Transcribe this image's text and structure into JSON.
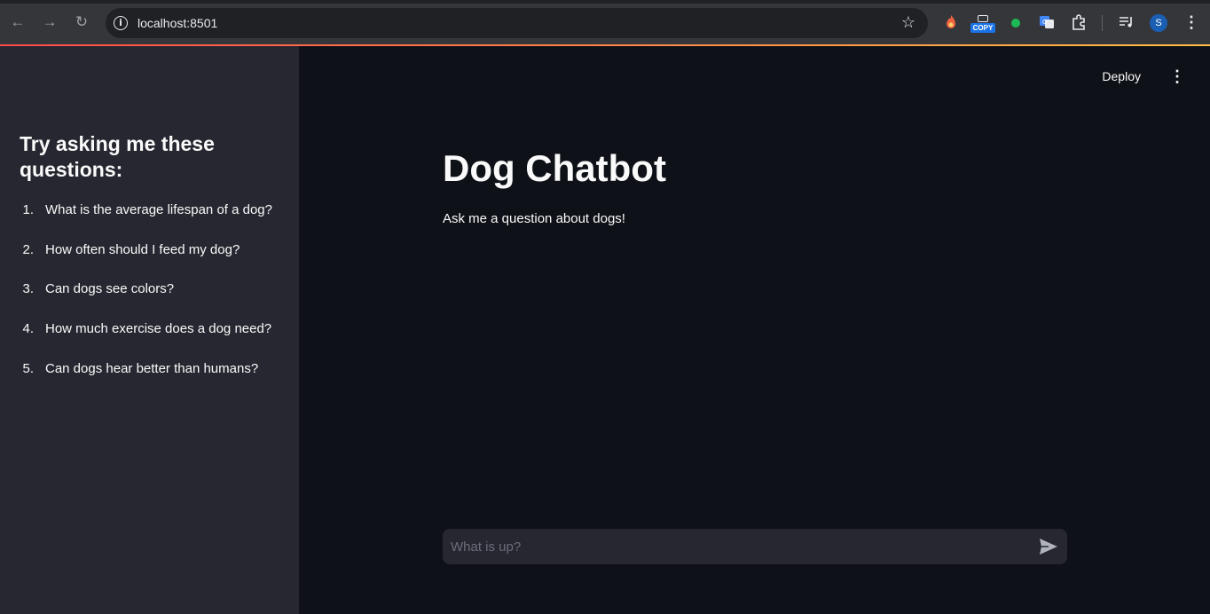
{
  "browser": {
    "url": "localhost:8501",
    "profile_initial": "S",
    "copy_ext_label": "COPY"
  },
  "sidebar": {
    "heading": "Try asking me these questions:",
    "questions": [
      {
        "num": "1.",
        "text": "What is the average lifespan of a dog?"
      },
      {
        "num": "2.",
        "text": "How often should I feed my dog?"
      },
      {
        "num": "3.",
        "text": "Can dogs see colors?"
      },
      {
        "num": "4.",
        "text": "How much exercise does a dog need?"
      },
      {
        "num": "5.",
        "text": "Can dogs hear better than humans?"
      }
    ]
  },
  "header": {
    "deploy_label": "Deploy"
  },
  "main": {
    "title": "Dog Chatbot",
    "subtitle": "Ask me a question about dogs!"
  },
  "chat": {
    "placeholder": "What is up?",
    "value": ""
  },
  "colors": {
    "sidebar_bg": "#262730",
    "main_bg": "#0e1117",
    "accent_start": "#ff4b4b",
    "accent_end": "#ffbd45"
  }
}
